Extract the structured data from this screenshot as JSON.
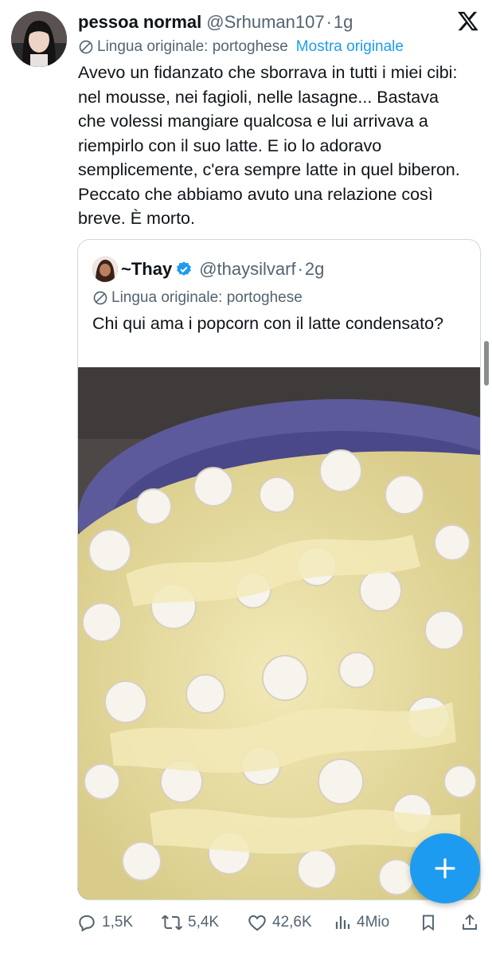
{
  "tweet": {
    "display_name": "pessoa normal",
    "handle": "@Srhuman107",
    "separator": "·",
    "time": "1g",
    "translation_note": "Lingua originale: portoghese",
    "show_original": "Mostra originale",
    "text": "Avevo un fidanzato che sborrava in tutti i miei cibi: nel mousse, nei fagioli, nelle lasagne... Bastava che volessi mangiare qualcosa e lui arrivava a riempirlo con il suo latte. E io lo adoravo semplicemente, c'era sempre latte in quel biberon. Peccato che abbiamo avuto una relazione così breve. È morto."
  },
  "quote": {
    "display_name": "~Thay",
    "handle": "@thaysilvarf",
    "separator": "·",
    "time": "2g",
    "translation_note": "Lingua originale: portoghese",
    "text": "Chi qui ama i popcorn con il latte condensato?"
  },
  "actions": {
    "replies": "1,5K",
    "reposts": "5,4K",
    "likes": "42,6K",
    "views": "4Mio"
  },
  "icons": {
    "platform_logo": "x-logo-icon",
    "verified": "verified-badge-icon",
    "reply": "reply-icon",
    "repost": "repost-icon",
    "like": "heart-icon",
    "views": "views-icon",
    "bookmark": "bookmark-icon",
    "share": "share-icon",
    "compose": "plus-icon",
    "translate": "translate-icon"
  },
  "colors": {
    "accent": "#1d9bf0",
    "text": "#0f1419",
    "secondary": "#536471",
    "border": "#cfd9de"
  }
}
